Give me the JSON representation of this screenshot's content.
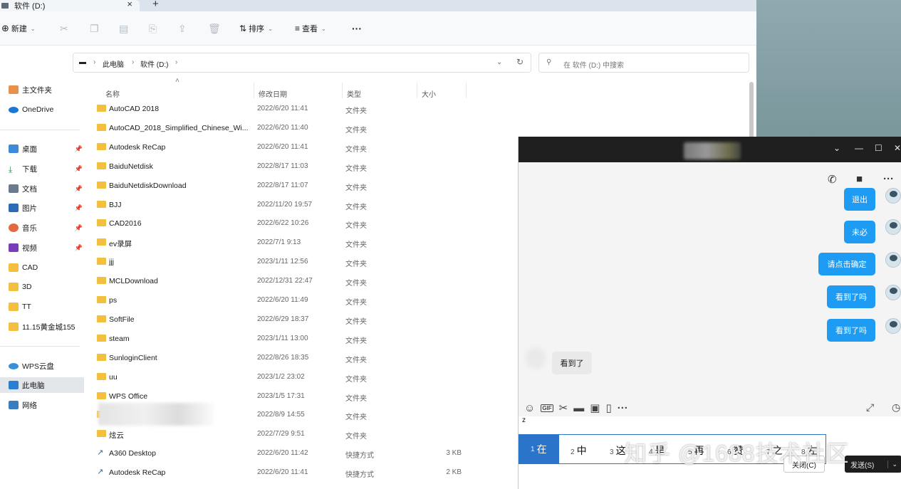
{
  "explorer": {
    "tab_title": "软件 (D:)",
    "toolbar": {
      "new_label": "新建",
      "sort_label": "排序",
      "view_label": "查看",
      "more_label": "···"
    },
    "breadcrumb": {
      "root": "此电脑",
      "current": "软件 (D:)"
    },
    "search_placeholder": "在 软件 (D:) 中搜索",
    "sidebar": {
      "home": "主文件夹",
      "onedrive": "OneDrive",
      "quick": [
        {
          "label": "桌面"
        },
        {
          "label": "下载"
        },
        {
          "label": "文档"
        },
        {
          "label": "图片"
        },
        {
          "label": "音乐"
        },
        {
          "label": "视频"
        },
        {
          "label": "CAD"
        },
        {
          "label": "3D"
        },
        {
          "label": "TT"
        },
        {
          "label": "11.15黄金城155"
        }
      ],
      "wps": "WPS云盘",
      "thispc": "此电脑",
      "network": "网络"
    },
    "columns": {
      "name": "名称",
      "date": "修改日期",
      "type": "类型",
      "size": "大小"
    },
    "files": [
      {
        "name": "AutoCAD 2018",
        "date": "2022/6/20 11:41",
        "type": "文件夹",
        "size": ""
      },
      {
        "name": "AutoCAD_2018_Simplified_Chinese_Wi...",
        "date": "2022/6/20 11:40",
        "type": "文件夹",
        "size": ""
      },
      {
        "name": "Autodesk ReCap",
        "date": "2022/6/20 11:41",
        "type": "文件夹",
        "size": ""
      },
      {
        "name": "BaiduNetdisk",
        "date": "2022/8/17 11:03",
        "type": "文件夹",
        "size": ""
      },
      {
        "name": "BaiduNetdiskDownload",
        "date": "2022/8/17 11:07",
        "type": "文件夹",
        "size": ""
      },
      {
        "name": "BJJ",
        "date": "2022/11/20 19:57",
        "type": "文件夹",
        "size": ""
      },
      {
        "name": "CAD2016",
        "date": "2022/6/22 10:26",
        "type": "文件夹",
        "size": ""
      },
      {
        "name": "ev录屏",
        "date": "2022/7/1 9:13",
        "type": "文件夹",
        "size": ""
      },
      {
        "name": "jjj",
        "date": "2023/1/11 12:56",
        "type": "文件夹",
        "size": ""
      },
      {
        "name": "MCLDownload",
        "date": "2022/12/31 22:47",
        "type": "文件夹",
        "size": ""
      },
      {
        "name": "ps",
        "date": "2022/6/20 11:49",
        "type": "文件夹",
        "size": ""
      },
      {
        "name": "SoftFile",
        "date": "2022/6/29 18:37",
        "type": "文件夹",
        "size": ""
      },
      {
        "name": "steam",
        "date": "2023/1/11 13:00",
        "type": "文件夹",
        "size": ""
      },
      {
        "name": "SunloginClient",
        "date": "2022/8/26 18:35",
        "type": "文件夹",
        "size": ""
      },
      {
        "name": "uu",
        "date": "2023/1/2 23:02",
        "type": "文件夹",
        "size": ""
      },
      {
        "name": "WPS Office",
        "date": "2023/1/5 17:31",
        "type": "文件夹",
        "size": ""
      },
      {
        "name": "",
        "date": "2022/8/9 14:55",
        "type": "文件夹",
        "size": ""
      },
      {
        "name": "炫云",
        "date": "2022/7/29 9:51",
        "type": "文件夹",
        "size": ""
      },
      {
        "name": "A360 Desktop",
        "date": "2022/6/20 11:42",
        "type": "快捷方式",
        "size": "3 KB"
      },
      {
        "name": "Autodesk ReCap",
        "date": "2022/6/20 11:41",
        "type": "快捷方式",
        "size": "2 KB"
      }
    ]
  },
  "chat": {
    "messages": [
      {
        "text": "退出",
        "dir": "out"
      },
      {
        "text": "未必",
        "dir": "out"
      },
      {
        "text": "请点击确定",
        "dir": "out"
      },
      {
        "text": "看到了吗",
        "dir": "out"
      },
      {
        "text": "看到了吗",
        "dir": "out"
      },
      {
        "text": "看到了",
        "dir": "in"
      }
    ],
    "input_text": "z",
    "ime_candidates": [
      {
        "n": "1",
        "text": "在"
      },
      {
        "n": "2",
        "text": "中"
      },
      {
        "n": "3",
        "text": "这"
      },
      {
        "n": "4",
        "text": "是"
      },
      {
        "n": "5",
        "text": "再"
      },
      {
        "n": "6",
        "text": "赞"
      },
      {
        "n": "7",
        "text": "之"
      },
      {
        "n": "8",
        "text": "左"
      }
    ],
    "close_label": "关闭(C)",
    "send_label": "发送(S)"
  },
  "watermark": "知乎 @1688技术社区",
  "colors": {
    "accent": "#1e9bf3",
    "ime_select": "#2a75c9",
    "folder": "#f2bf3f"
  }
}
